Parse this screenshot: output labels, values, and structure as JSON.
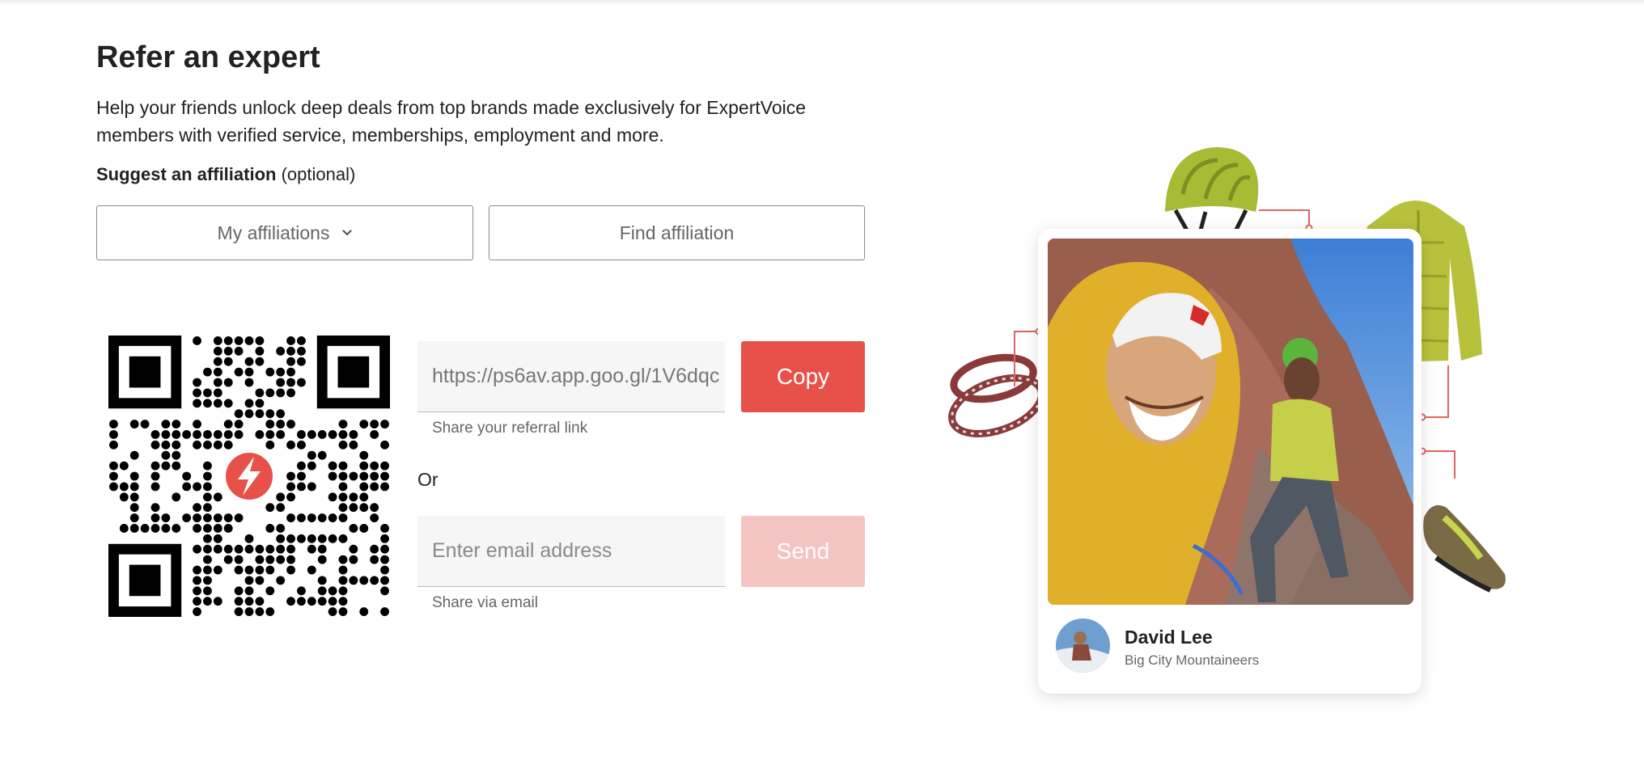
{
  "page": {
    "title": "Refer an expert",
    "description": "Help your friends unlock deep deals from top brands made exclusively for ExpertVoice members with verified service, memberships, employment and more."
  },
  "affiliation": {
    "label_bold": "Suggest an affiliation",
    "label_optional": "(optional)",
    "my_affiliations_label": "My affiliations",
    "find_affiliation_label": "Find affiliation"
  },
  "referral": {
    "link_value": "https://ps6av.app.goo.gl/1V6dqc",
    "link_help": "Share your referral link",
    "copy_label": "Copy",
    "or_label": "Or",
    "email_placeholder": "Enter email address",
    "email_help": "Share via email",
    "send_label": "Send"
  },
  "profile_card": {
    "name": "David Lee",
    "organization": "Big City Mountaineers"
  },
  "icons": {
    "qr_center": "lightning-bolt-icon",
    "dropdown": "chevron-down-icon"
  },
  "colors": {
    "accent": "#e8514a",
    "accent_disabled": "#f4c4c2",
    "gear_green": "#b5c43a"
  }
}
